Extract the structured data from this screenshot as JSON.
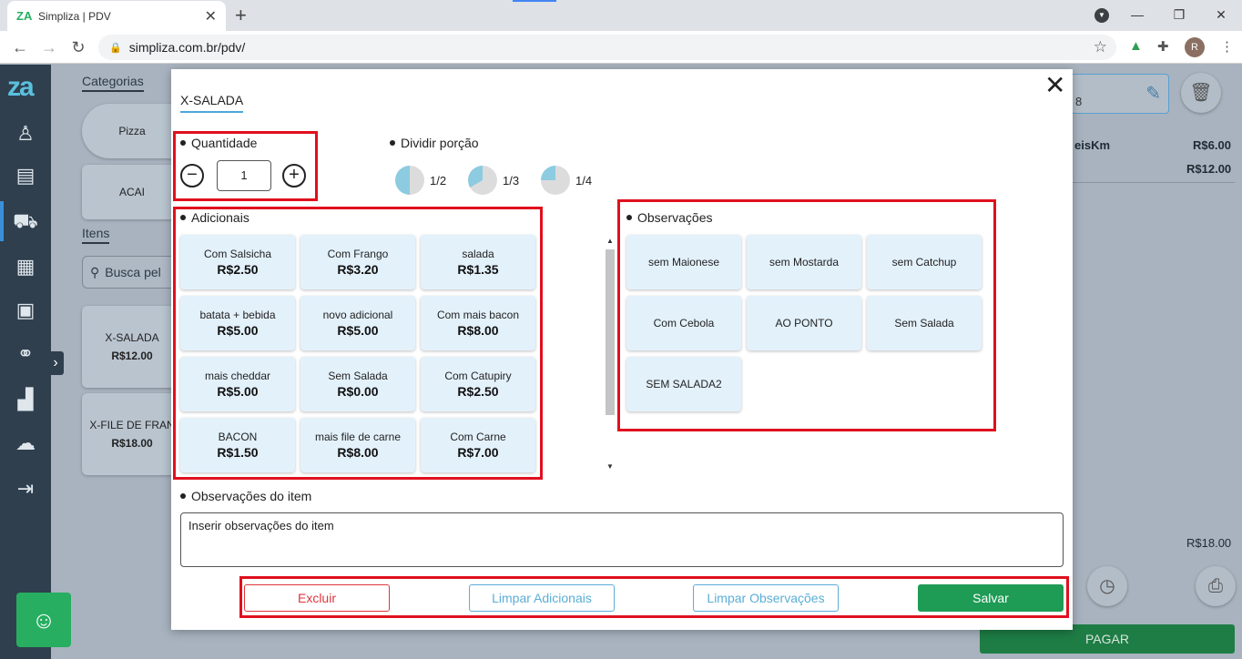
{
  "browser": {
    "tab_title": "Simpliza | PDV",
    "tab_favicon": "ZA",
    "url": "simpliza.com.br/pdv/",
    "profile_initial": "R"
  },
  "background": {
    "categories_title": "Categorias",
    "categories": [
      "Pizza",
      "ACAI"
    ],
    "itens_title": "Itens",
    "search_placeholder": "Busca pel",
    "items": [
      {
        "name": "X-SALADA",
        "price": "R$12.00"
      },
      {
        "name": "X-FILE DE FRAN",
        "price": "R$18.00"
      }
    ],
    "right_field_text": "8",
    "order_lines": [
      {
        "name": "eisKm",
        "price": "R$6.00"
      },
      {
        "name": "",
        "price": "R$12.00"
      }
    ],
    "total": "R$18.00",
    "pay_label": "PAGAR"
  },
  "modal": {
    "title": "X-SALADA",
    "quantity_label": "Quantidade",
    "quantity_value": "1",
    "split_label": "Dividir porção",
    "portions": [
      {
        "label": "1/2",
        "fraction": 0.5
      },
      {
        "label": "1/3",
        "fraction": 0.333
      },
      {
        "label": "1/4",
        "fraction": 0.25
      }
    ],
    "additions_label": "Adicionais",
    "additions": [
      {
        "name": "Com Salsicha",
        "price": "R$2.50"
      },
      {
        "name": "Com Frango",
        "price": "R$3.20"
      },
      {
        "name": "salada",
        "price": "R$1.35"
      },
      {
        "name": "batata + bebida",
        "price": "R$5.00"
      },
      {
        "name": "novo adicional",
        "price": "R$5.00"
      },
      {
        "name": "Com mais bacon",
        "price": "R$8.00"
      },
      {
        "name": "mais cheddar",
        "price": "R$5.00"
      },
      {
        "name": "Sem Salada",
        "price": "R$0.00"
      },
      {
        "name": "Com Catupiry",
        "price": "R$2.50"
      },
      {
        "name": "BACON",
        "price": "R$1.50"
      },
      {
        "name": "mais file de carne",
        "price": "R$8.00"
      },
      {
        "name": "Com Carne",
        "price": "R$7.00"
      }
    ],
    "observations_label": "Observações",
    "observations": [
      "sem Maionese",
      "sem Mostarda",
      "sem Catchup",
      "Com Cebola",
      "AO PONTO",
      "Sem Salada",
      "SEM SALADA2"
    ],
    "item_obs_label": "Observações do item",
    "item_obs_placeholder": "Inserir observações do item",
    "buttons": {
      "delete": "Excluir",
      "clear_additions": "Limpar Adicionais",
      "clear_observations": "Limpar Observações",
      "save": "Salvar"
    }
  },
  "colors": {
    "accent_green": "#1e9b55",
    "danger_red": "#e0363c",
    "highlight_box": "#e0101e",
    "card_bg": "#e3f1fb",
    "pie_fill": "#8ccbe0"
  }
}
